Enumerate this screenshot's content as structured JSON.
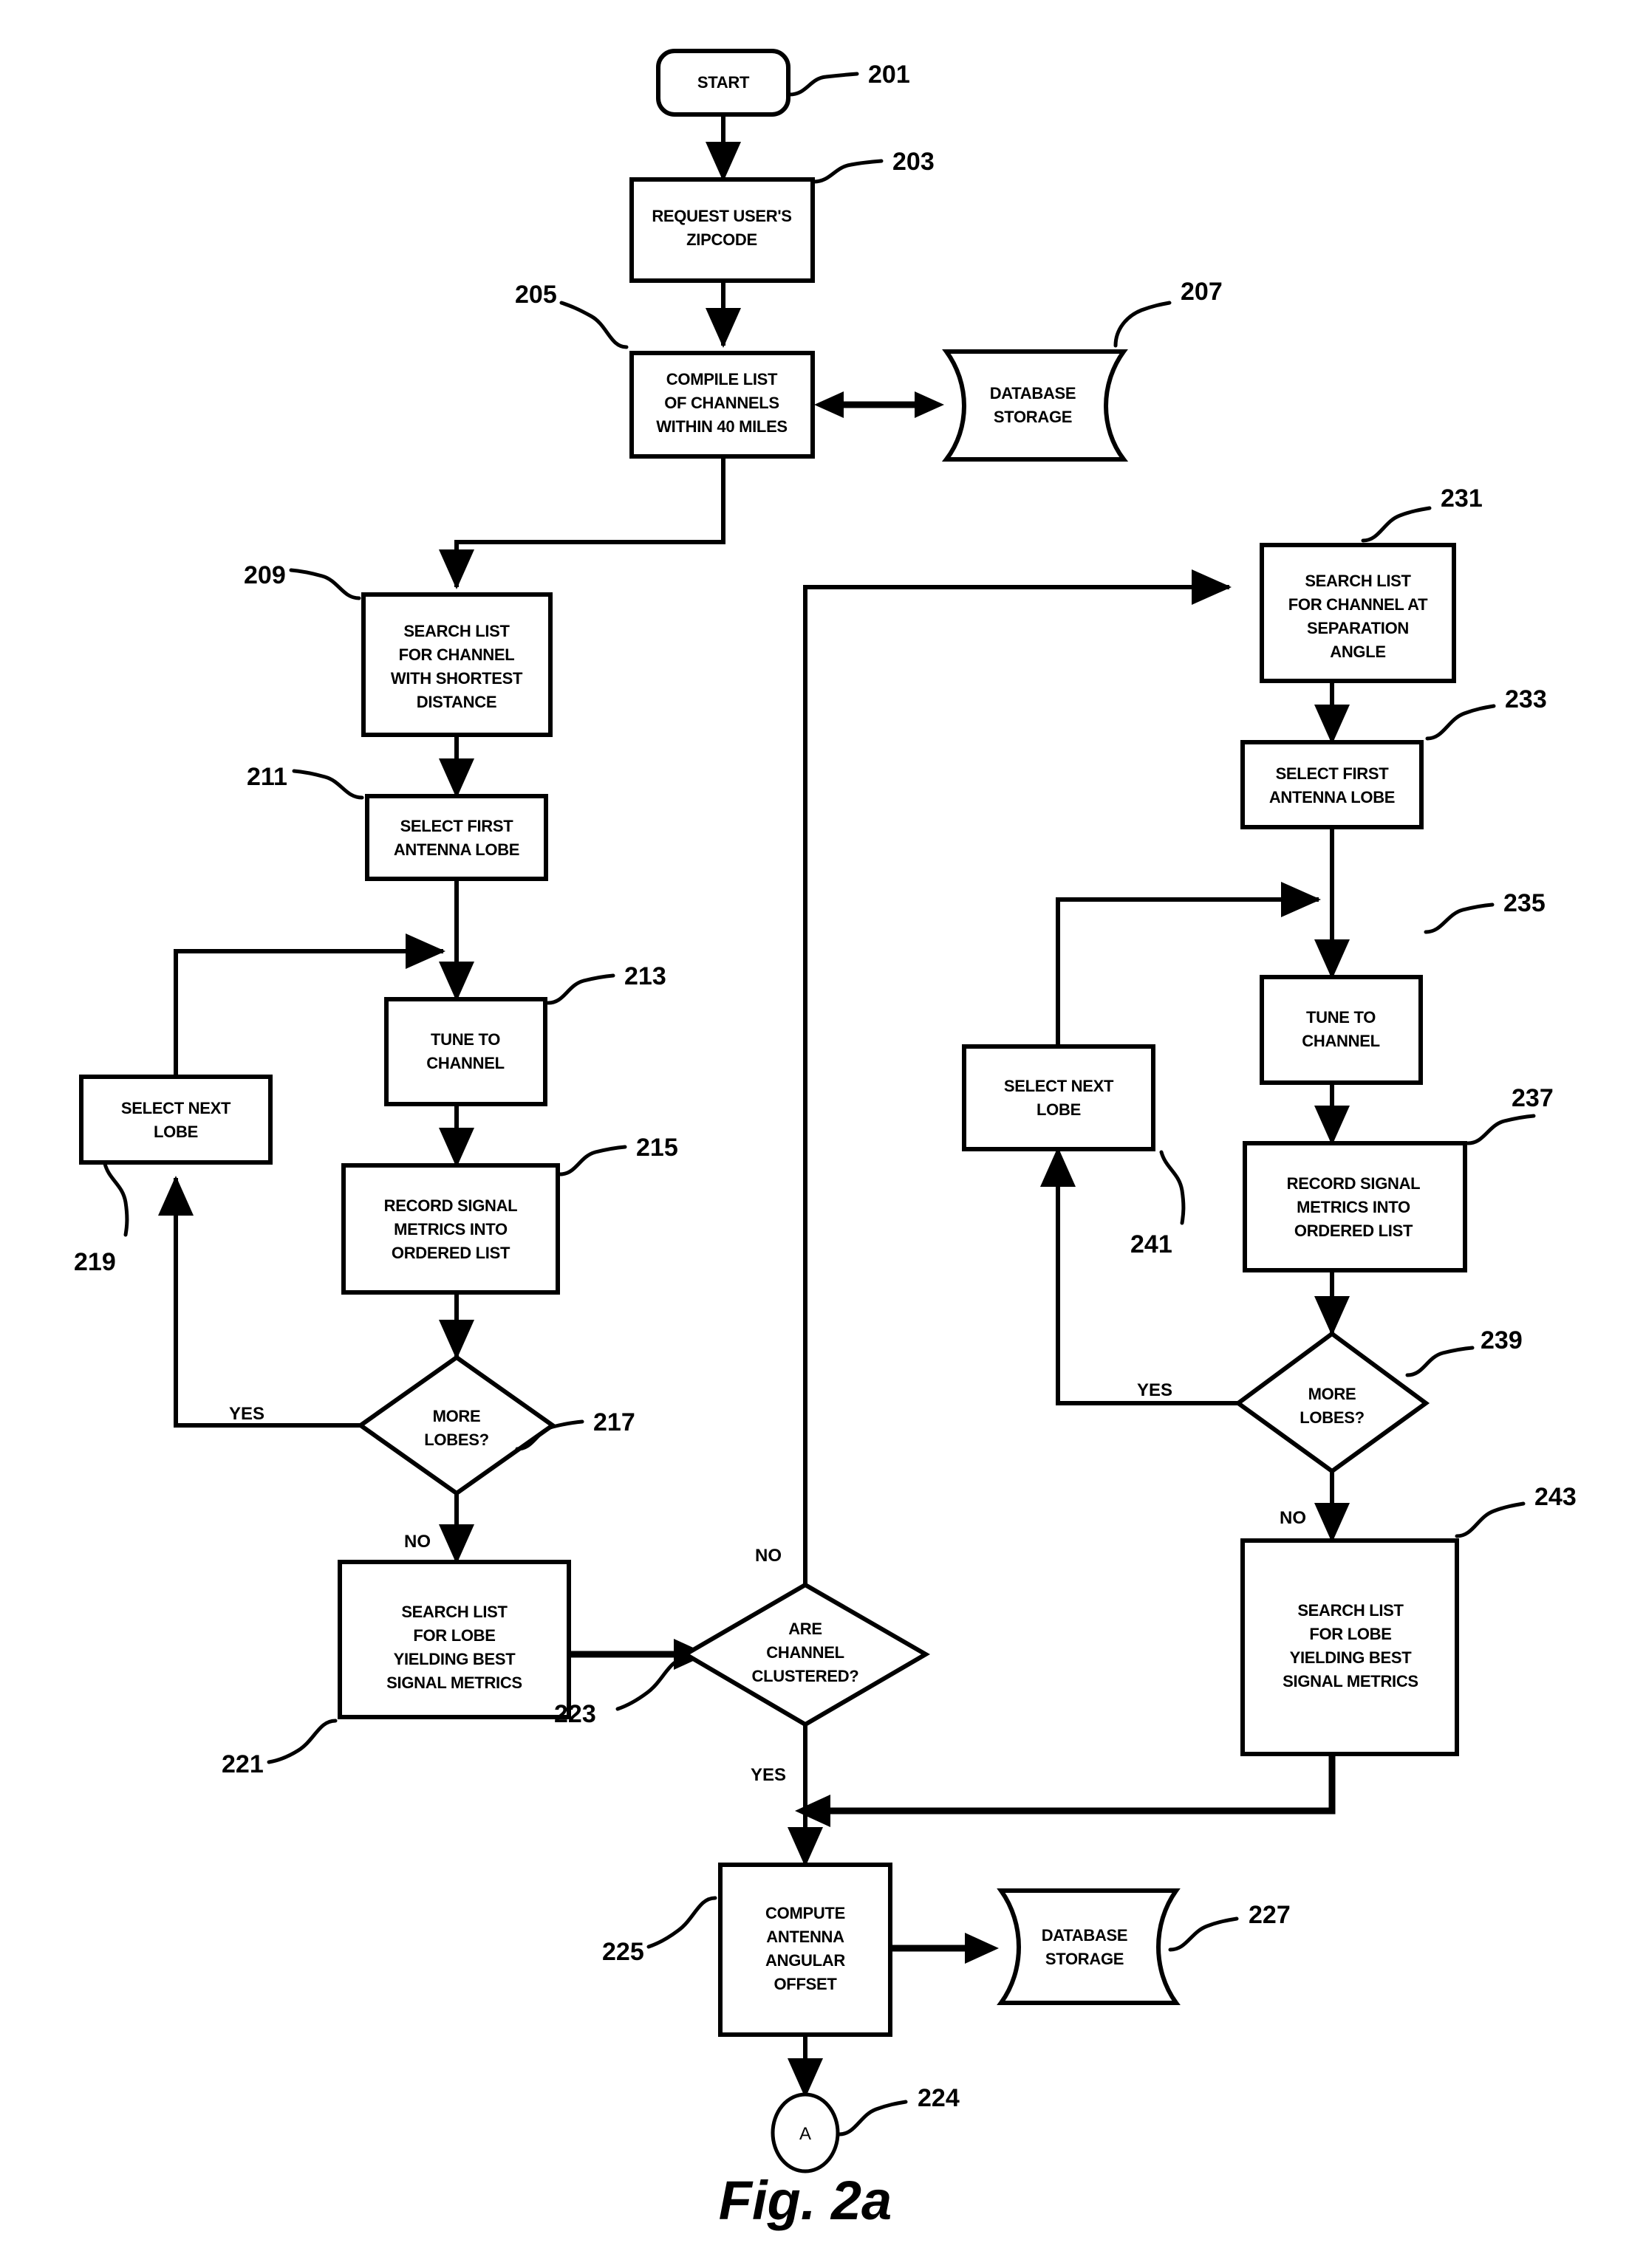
{
  "figure": {
    "caption": "Fig. 2a"
  },
  "nodes": {
    "start": {
      "ref": "201",
      "lines": [
        "START"
      ],
      "shape": "terminator"
    },
    "request_zip": {
      "ref": "203",
      "lines": [
        "REQUEST USER'S",
        "ZIPCODE"
      ],
      "shape": "process"
    },
    "compile_list": {
      "ref": "205",
      "lines": [
        "COMPILE LIST",
        "OF CHANNELS",
        "WITHIN 40 MILES"
      ],
      "shape": "process"
    },
    "db_storage_top": {
      "ref": "207",
      "lines": [
        "DATABASE",
        "STORAGE"
      ],
      "shape": "database"
    },
    "search_shortest": {
      "ref": "209",
      "lines": [
        "SEARCH LIST",
        "FOR CHANNEL",
        "WITH SHORTEST",
        "DISTANCE"
      ],
      "shape": "process"
    },
    "select_first_lobe_left": {
      "ref": "211",
      "lines": [
        "SELECT FIRST",
        "ANTENNA LOBE"
      ],
      "shape": "process"
    },
    "tune_channel_left": {
      "ref": "213",
      "lines": [
        "TUNE TO",
        "CHANNEL"
      ],
      "shape": "process"
    },
    "record_metrics_left": {
      "ref": "215",
      "lines": [
        "RECORD SIGNAL",
        "METRICS INTO",
        "ORDERED LIST"
      ],
      "shape": "process"
    },
    "more_lobes_left": {
      "ref": "217",
      "lines": [
        "MORE",
        "LOBES?"
      ],
      "shape": "decision"
    },
    "select_next_lobe_left": {
      "ref": "219",
      "lines": [
        "SELECT NEXT",
        "LOBE"
      ],
      "shape": "process"
    },
    "search_best_left": {
      "ref": "221",
      "lines": [
        "SEARCH LIST",
        "FOR LOBE",
        "YIELDING BEST",
        "SIGNAL METRICS"
      ],
      "shape": "process"
    },
    "channels_clustered": {
      "ref": "223",
      "lines": [
        "ARE",
        "CHANNEL",
        "CLUSTERED?"
      ],
      "shape": "decision"
    },
    "connector_a": {
      "ref": "224",
      "lines": [
        "A"
      ],
      "shape": "connector"
    },
    "compute_offset": {
      "ref": "225",
      "lines": [
        "COMPUTE",
        "ANTENNA",
        "ANGULAR",
        "OFFSET"
      ],
      "shape": "process"
    },
    "db_storage_bottom": {
      "ref": "227",
      "lines": [
        "DATABASE",
        "STORAGE"
      ],
      "shape": "database"
    },
    "search_separation": {
      "ref": "231",
      "lines": [
        "SEARCH LIST",
        "FOR CHANNEL AT",
        "SEPARATION",
        "ANGLE"
      ],
      "shape": "process"
    },
    "select_first_lobe_right": {
      "ref": "233",
      "lines": [
        "SELECT FIRST",
        "ANTENNA LOBE"
      ],
      "shape": "process"
    },
    "tune_channel_right": {
      "ref": "235",
      "lines": [
        "TUNE TO",
        "CHANNEL"
      ],
      "shape": "process"
    },
    "record_metrics_right": {
      "ref": "237",
      "lines": [
        "RECORD SIGNAL",
        "METRICS INTO",
        "ORDERED LIST"
      ],
      "shape": "process"
    },
    "more_lobes_right": {
      "ref": "239",
      "lines": [
        "MORE",
        "LOBES?"
      ],
      "shape": "decision"
    },
    "select_next_lobe_right": {
      "ref": "241",
      "lines": [
        "SELECT NEXT",
        "LOBE"
      ],
      "shape": "process"
    },
    "search_best_right": {
      "ref": "243",
      "lines": [
        "SEARCH LIST",
        "FOR LOBE",
        "YIELDING BEST",
        "SIGNAL METRICS"
      ],
      "shape": "process"
    }
  },
  "branch_labels": {
    "left_more_lobes_yes": "YES",
    "left_more_lobes_no": "NO",
    "clustered_no": "NO",
    "clustered_yes": "YES",
    "right_more_lobes_yes": "YES",
    "right_more_lobes_no": "NO"
  },
  "colors": {
    "line": "#000000",
    "fill": "#ffffff"
  }
}
